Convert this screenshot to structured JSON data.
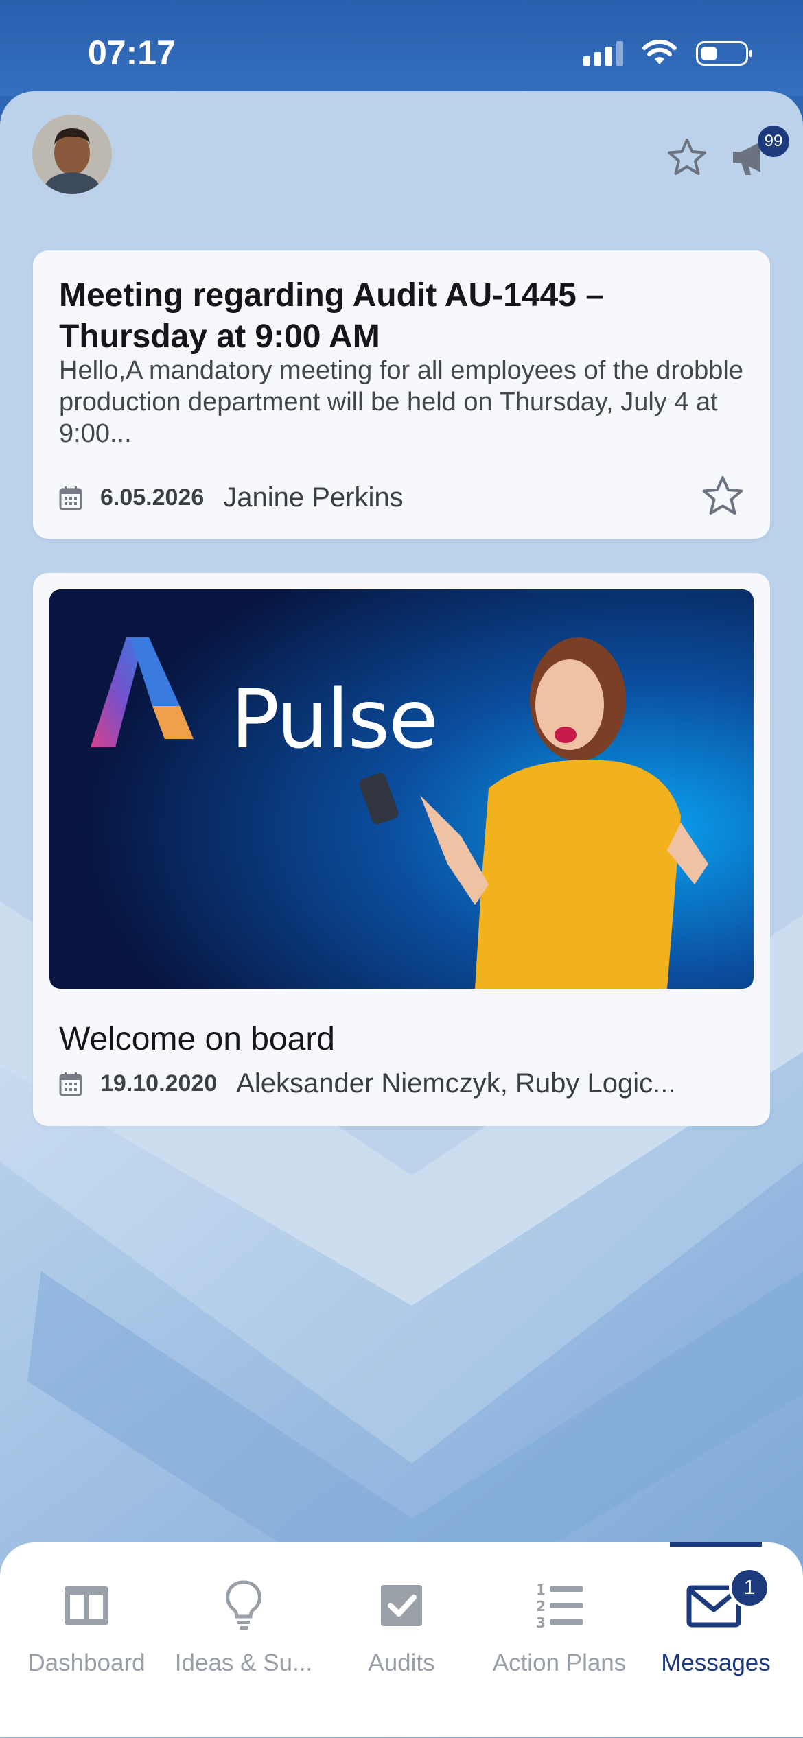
{
  "status_bar": {
    "time": "07:17"
  },
  "header": {
    "notifications_badge": "99",
    "icons": [
      "avatar",
      "star-icon",
      "megaphone-icon"
    ]
  },
  "messages": [
    {
      "title": "Meeting regarding Audit AU-1445 – Thursday at 9:00 AM",
      "body": "Hello,A mandatory meeting for all employees of the drobble production department will be held on Thursday, July 4 at 9:00...",
      "date": "6.05.2026",
      "author": "Janine Perkins"
    },
    {
      "banner_text": "Pulse",
      "title": "Welcome on board",
      "date": "19.10.2020",
      "author": "Aleksander Niemczyk, Ruby Logic..."
    }
  ],
  "tabs": [
    {
      "label": "Dashboard",
      "icon": "dashboard-icon"
    },
    {
      "label": "Ideas & Su...",
      "icon": "lightbulb-icon"
    },
    {
      "label": "Audits",
      "icon": "checkbox-icon"
    },
    {
      "label": "Action Plans",
      "icon": "numbered-list-icon"
    },
    {
      "label": "Messages",
      "icon": "envelope-icon",
      "badge": "1",
      "active": true
    }
  ],
  "colors": {
    "status_bar": "#2f66b3",
    "background": "#bcd2ea",
    "accent": "#1d3a7c",
    "inactive_tab": "#9aa0a8"
  }
}
